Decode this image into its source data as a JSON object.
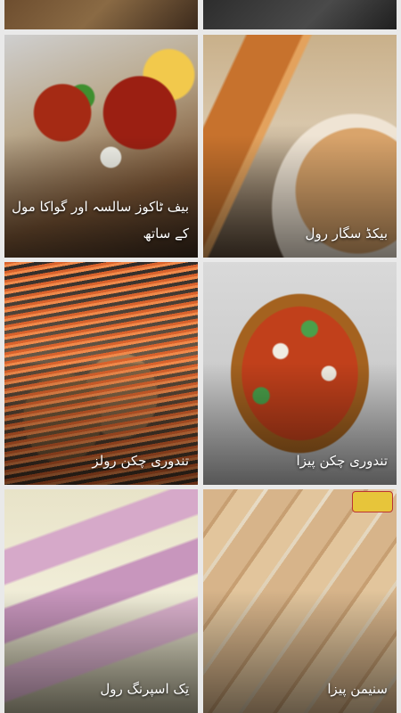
{
  "recipes": [
    {
      "title": "بیف ٹاکوز سالسہ اور گواکا مول کے ساتھ"
    },
    {
      "title": "بیکڈ سگار رول"
    },
    {
      "title": "تندوری چکن رولز"
    },
    {
      "title": "تندوری چکن پیزا"
    },
    {
      "title": "تِک اسپرنگ رول"
    },
    {
      "title": "سنیمن پیزا"
    }
  ]
}
